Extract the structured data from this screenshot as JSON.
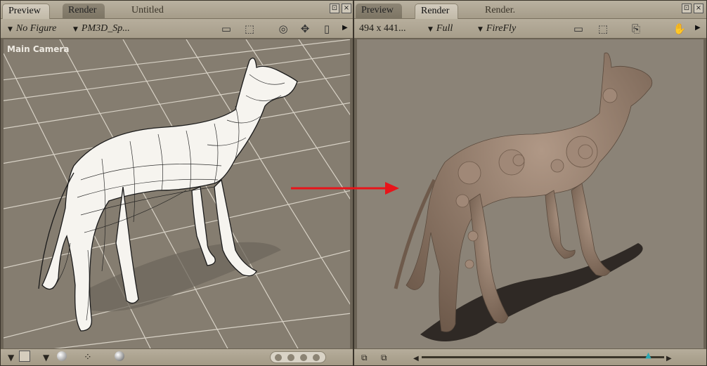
{
  "left_panel": {
    "tabs": [
      "Preview",
      "Render",
      "Untitled"
    ],
    "figure_dropdown": "No Figure",
    "figure_name_dropdown": "PM3D_Sp...",
    "camera_label": "Main Camera",
    "window_controls": [
      "resize-icon",
      "close-icon"
    ],
    "toolbar_icons": [
      "camera-icon",
      "select-camera-icon",
      "rotate-trackball-icon",
      "move-cross-icon",
      "scale-icon",
      "more-arrow-icon"
    ]
  },
  "right_panel": {
    "tabs": [
      "Preview",
      "Render",
      "Render."
    ],
    "size_dropdown": "494 x 441...",
    "quality_dropdown": "Full",
    "engine_dropdown": "FireFly",
    "window_controls": [
      "resize-icon",
      "close-icon"
    ],
    "toolbar_icons": [
      "render-camera-icon",
      "area-render-icon",
      "save-render-icon",
      "hand-pan-icon",
      "more-arrow-icon"
    ],
    "slider_level": 0.94
  },
  "colors": {
    "arrow": "#e8141a",
    "background": "#857d70",
    "render_bg": "#8b8377",
    "slider_thumb": "#2aa9b5"
  }
}
